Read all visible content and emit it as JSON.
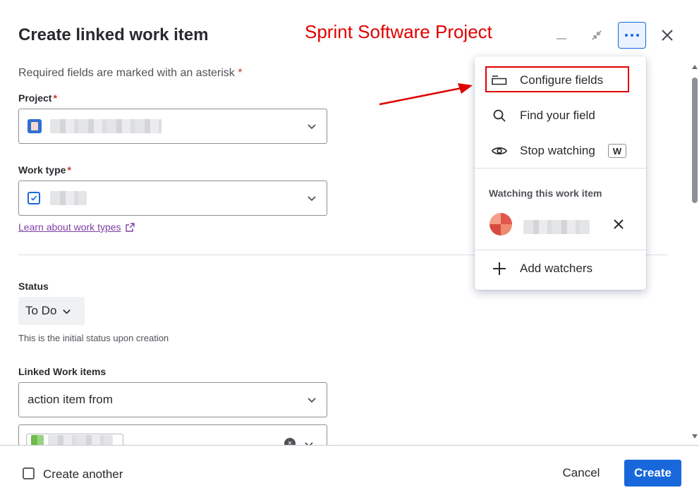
{
  "modal": {
    "title": "Create linked work item",
    "annotation": "Sprint Software Project",
    "required_note": "Required fields are marked with an asterisk",
    "required_star": "*"
  },
  "header_buttons": {
    "minimize_icon": "minimize-icon",
    "collapse_icon": "collapse-icon",
    "more_icon": "more-horizontal-icon",
    "close_icon": "close-icon"
  },
  "fields": {
    "project": {
      "label": "Project",
      "star": "*"
    },
    "work_type": {
      "label": "Work type",
      "star": "*"
    },
    "learn_link": "Learn about work types",
    "status": {
      "label": "Status",
      "value": "To Do",
      "help": "This is the initial status upon creation"
    },
    "linked": {
      "label": "Linked Work items",
      "value": "action item from"
    }
  },
  "menu": {
    "items": [
      {
        "label": "Configure fields",
        "icon": "configure-icon"
      },
      {
        "label": "Find your field",
        "icon": "search-icon"
      },
      {
        "label": "Stop watching",
        "icon": "eye-icon",
        "shortcut": "W"
      }
    ],
    "watching_heading": "Watching this work item",
    "add_watchers": "Add watchers"
  },
  "footer": {
    "create_another": "Create another",
    "cancel": "Cancel",
    "create": "Create"
  },
  "colors": {
    "primary": "#1868db",
    "annotation_red": "#e10000",
    "required_red": "#c9372c",
    "link_purple": "#803fa5"
  }
}
